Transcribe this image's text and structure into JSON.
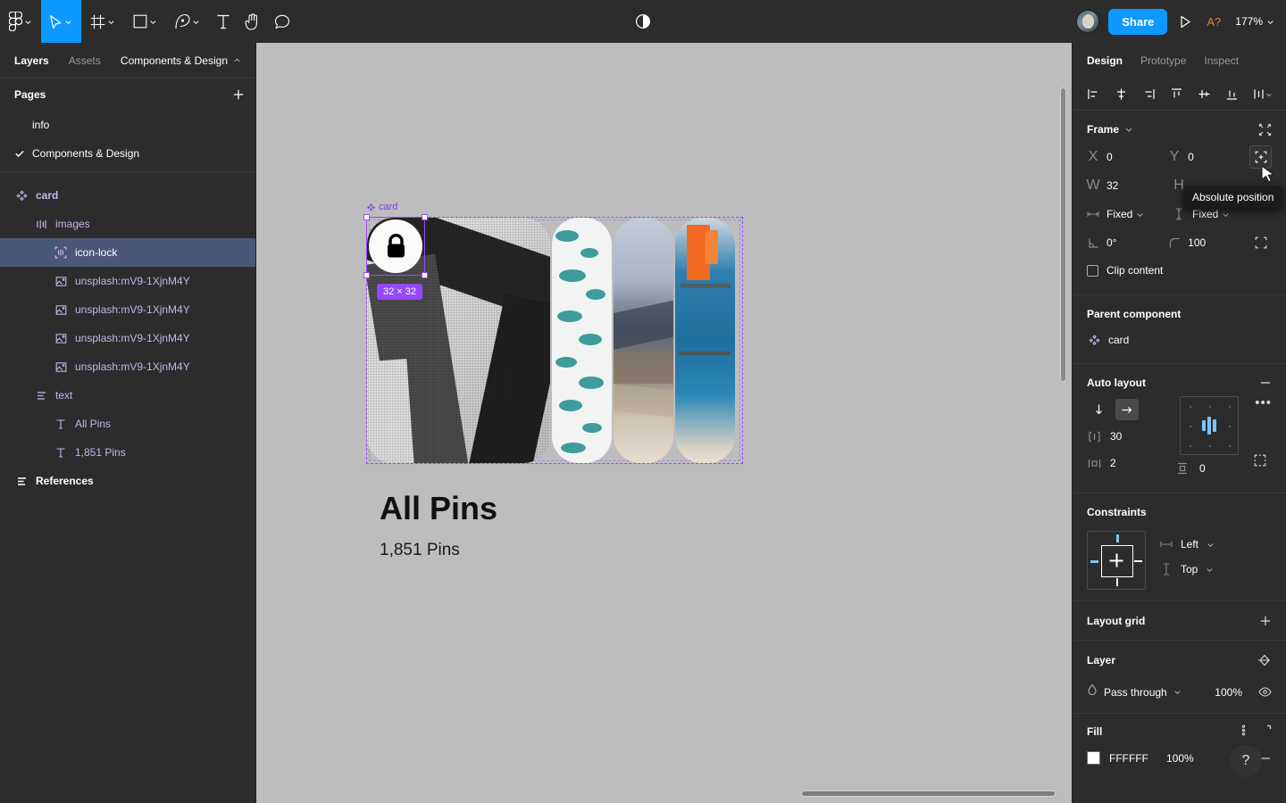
{
  "toolbar": {
    "tools": [
      {
        "name": "figma-logo-icon",
        "label": "Figma menu",
        "caret": true,
        "active": false
      },
      {
        "name": "move-tool-icon",
        "label": "Move",
        "caret": true,
        "active": true
      },
      {
        "name": "frame-tool-icon",
        "label": "Frame",
        "caret": true,
        "active": false
      },
      {
        "name": "shape-tool-icon",
        "label": "Rectangle",
        "caret": true,
        "active": false
      },
      {
        "name": "pen-tool-icon",
        "label": "Pen",
        "caret": true,
        "active": false
      },
      {
        "name": "text-tool-icon",
        "label": "Text",
        "caret": false,
        "active": false
      },
      {
        "name": "hand-tool-icon",
        "label": "Hand",
        "caret": false,
        "active": false
      },
      {
        "name": "comment-tool-icon",
        "label": "Comment",
        "caret": false,
        "active": false
      }
    ],
    "center_icon": "contrast-icon",
    "share_label": "Share",
    "present_icon": "play-icon",
    "assistant_badge": "A?",
    "zoom_level": "177%"
  },
  "left_panel": {
    "tabs": [
      {
        "label": "Layers",
        "active": true
      },
      {
        "label": "Assets",
        "active": false
      }
    ],
    "file_name": "Components & Design",
    "pages_label": "Pages",
    "pages": [
      {
        "label": "info",
        "selected": false
      },
      {
        "label": "Components & Design",
        "selected": true
      }
    ],
    "layers": [
      {
        "label": "card",
        "icon": "component-icon",
        "depth": 0,
        "selected": false,
        "bold": true
      },
      {
        "label": "images",
        "icon": "auto-layout-horizontal-icon",
        "depth": 1,
        "selected": false,
        "bold": false
      },
      {
        "label": "icon-lock",
        "icon": "instance-icon",
        "depth": 2,
        "selected": true,
        "bold": false
      },
      {
        "label": "unsplash:mV9-1XjnM4Y",
        "icon": "image-icon",
        "depth": 2,
        "selected": false,
        "bold": false
      },
      {
        "label": "unsplash:mV9-1XjnM4Y",
        "icon": "image-icon",
        "depth": 2,
        "selected": false,
        "bold": false
      },
      {
        "label": "unsplash:mV9-1XjnM4Y",
        "icon": "image-icon",
        "depth": 2,
        "selected": false,
        "bold": false
      },
      {
        "label": "unsplash:mV9-1XjnM4Y",
        "icon": "image-icon",
        "depth": 2,
        "selected": false,
        "bold": false
      },
      {
        "label": "text",
        "icon": "auto-layout-vertical-icon",
        "depth": 1,
        "selected": false,
        "bold": false
      },
      {
        "label": "All Pins",
        "icon": "text-layer-icon",
        "depth": 2,
        "selected": false,
        "bold": false
      },
      {
        "label": "1,851 Pins",
        "icon": "text-layer-icon",
        "depth": 2,
        "selected": false,
        "bold": false
      },
      {
        "label": "References",
        "icon": "auto-layout-vertical-icon",
        "depth": 0,
        "selected": false,
        "bold": true,
        "white": true
      }
    ]
  },
  "canvas": {
    "frame_label": "card",
    "selection_size": "32 × 32",
    "card_title": "All Pins",
    "card_subtitle": "1,851 Pins"
  },
  "right_panel": {
    "tabs": [
      {
        "label": "Design",
        "active": true
      },
      {
        "label": "Prototype",
        "active": false
      },
      {
        "label": "Inspect",
        "active": false
      }
    ],
    "align_buttons": [
      "align-left-icon",
      "align-horizontal-center-icon",
      "align-right-icon",
      "align-top-icon",
      "align-vertical-center-icon",
      "align-bottom-icon",
      "distribute-icon"
    ],
    "frame": {
      "title": "Frame",
      "x_label": "X",
      "x_value": "0",
      "y_label": "Y",
      "y_value": "0",
      "w_label": "W",
      "w_value": "32",
      "h_label": "H",
      "h_value": "",
      "resize_w": "Fixed",
      "resize_h": "Fixed",
      "rotation": "0°",
      "corner_radius": "100",
      "clip_content_label": "Clip content"
    },
    "parent_component": {
      "title": "Parent component",
      "name": "card"
    },
    "auto_layout": {
      "title": "Auto layout",
      "direction_vertical": "↓",
      "direction_horizontal": "→",
      "gap": "30",
      "padding_horizontal": "2",
      "padding_vertical": "0"
    },
    "constraints": {
      "title": "Constraints",
      "horizontal": "Left",
      "vertical": "Top"
    },
    "layout_grid": {
      "title": "Layout grid"
    },
    "layer": {
      "title": "Layer",
      "blend_mode": "Pass through",
      "opacity": "100%"
    },
    "fill": {
      "title": "Fill",
      "hex": "FFFFFF",
      "opacity": "100%"
    },
    "tooltip": "Absolute position"
  },
  "help": {
    "label": "?"
  },
  "colors": {
    "accent_blue": "#0d99ff",
    "selection_purple": "#9747ff",
    "layer_purple": "#c4b5e8",
    "panel_bg": "#2c2c2c",
    "canvas_bg": "#bdbdbd",
    "row_selected": "#4a5878",
    "orange": "#e0812a"
  }
}
